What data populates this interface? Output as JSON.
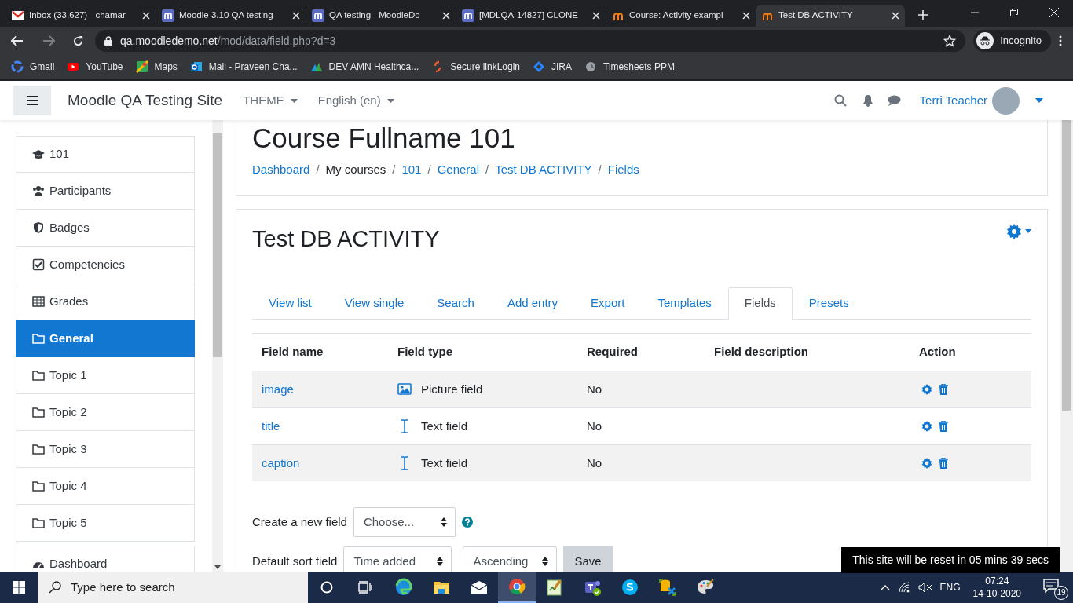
{
  "browser": {
    "tabs": [
      {
        "title": "Inbox (33,627) - chamar",
        "kind": "mail",
        "selected": false
      },
      {
        "title": "Moodle 3.10 QA testing",
        "kind": "moodle",
        "selected": false
      },
      {
        "title": "QA testing - MoodleDo",
        "kind": "moodle",
        "selected": false
      },
      {
        "title": "[MDLQA-14827] CLONE",
        "kind": "moodle",
        "selected": false
      },
      {
        "title": "Course: Activity exampl",
        "kind": "moodle-orange",
        "selected": false
      },
      {
        "title": "Test DB ACTIVITY",
        "kind": "moodle-orange",
        "selected": true
      }
    ],
    "address": {
      "host": "qa.moodledemo.net",
      "path": "/mod/data/field.php?d=3"
    },
    "profile": "Incognito",
    "bookmarks": [
      {
        "label": "Gmail",
        "kind": "google"
      },
      {
        "label": "YouTube",
        "kind": "youtube"
      },
      {
        "label": "Maps",
        "kind": "maps"
      },
      {
        "label": "Mail - Praveen Cha...",
        "kind": "outlook"
      },
      {
        "label": "DEV AMN Healthca...",
        "kind": "triangles"
      },
      {
        "label": "Secure linkLogin",
        "kind": "swirl"
      },
      {
        "label": "JIRA",
        "kind": "diamond"
      },
      {
        "label": "Timesheets PPM",
        "kind": "disc"
      }
    ]
  },
  "navbar": {
    "site_name": "Moodle QA Testing Site",
    "menus": [
      "THEME",
      "English (en)"
    ],
    "user": "Terri Teacher"
  },
  "sidebar": {
    "items": [
      {
        "label": "101",
        "kind": "cap",
        "selected": false
      },
      {
        "label": "Participants",
        "kind": "users",
        "selected": false
      },
      {
        "label": "Badges",
        "kind": "shield",
        "selected": false
      },
      {
        "label": "Competencies",
        "kind": "check",
        "selected": false
      },
      {
        "label": "Grades",
        "kind": "table",
        "selected": false
      },
      {
        "label": "General",
        "kind": "folder",
        "selected": true
      },
      {
        "label": "Topic 1",
        "kind": "folder",
        "selected": false
      },
      {
        "label": "Topic 2",
        "kind": "folder",
        "selected": false
      },
      {
        "label": "Topic 3",
        "kind": "folder",
        "selected": false
      },
      {
        "label": "Topic 4",
        "kind": "folder",
        "selected": false
      },
      {
        "label": "Topic 5",
        "kind": "folder",
        "selected": false
      }
    ],
    "footer_item": {
      "label": "Dashboard",
      "kind": "gauge"
    }
  },
  "header": {
    "course_title": "Course Fullname 101",
    "breadcrumb": [
      {
        "label": "Dashboard",
        "kind": "link"
      },
      {
        "label": "/",
        "kind": "separator"
      },
      {
        "label": "My courses",
        "kind": "text"
      },
      {
        "label": "/",
        "kind": "separator"
      },
      {
        "label": "101",
        "kind": "link"
      },
      {
        "label": "/",
        "kind": "separator"
      },
      {
        "label": "General",
        "kind": "link"
      },
      {
        "label": "/",
        "kind": "separator"
      },
      {
        "label": "Test DB ACTIVITY",
        "kind": "link"
      },
      {
        "label": "/",
        "kind": "separator"
      },
      {
        "label": "Fields",
        "kind": "link"
      }
    ]
  },
  "activity": {
    "title": "Test DB ACTIVITY",
    "tabs": [
      {
        "label": "View list",
        "selected": false
      },
      {
        "label": "View single",
        "selected": false
      },
      {
        "label": "Search",
        "selected": false
      },
      {
        "label": "Add entry",
        "selected": false
      },
      {
        "label": "Export",
        "selected": false
      },
      {
        "label": "Templates",
        "selected": false
      },
      {
        "label": "Fields",
        "selected": true
      },
      {
        "label": "Presets",
        "selected": false
      }
    ],
    "table": {
      "columns": [
        "Field name",
        "Field type",
        "Required",
        "Field description",
        "Action"
      ],
      "rows": [
        {
          "field_name": "image",
          "field_type": "Picture field",
          "kind": "picture",
          "required": "No"
        },
        {
          "field_name": "title",
          "field_type": "Text field",
          "kind": "text",
          "required": "No"
        },
        {
          "field_name": "caption",
          "field_type": "Text field",
          "kind": "text",
          "required": "No"
        }
      ]
    },
    "create_field": {
      "label": "Create a new field",
      "select": "Choose..."
    },
    "sort": {
      "label": "Default sort field",
      "field": "Time added",
      "order": "Ascending",
      "button": "Save"
    }
  },
  "reset_notice": "This site will be reset in 05 mins 39 secs",
  "taskbar": {
    "search_placeholder": "Type here to search",
    "apps": [
      {
        "kind": "edge",
        "selected": false
      },
      {
        "kind": "folder",
        "selected": false
      },
      {
        "kind": "mail",
        "selected": false
      },
      {
        "kind": "chrome",
        "selected": true
      },
      {
        "kind": "notepad",
        "selected": false
      },
      {
        "kind": "teams",
        "selected": false
      },
      {
        "kind": "skype",
        "selected": false
      },
      {
        "kind": "tool",
        "selected": false
      },
      {
        "kind": "paint",
        "selected": false
      }
    ],
    "language": "ENG",
    "time": "07:24",
    "date": "14-10-2020",
    "notifications": "19"
  }
}
